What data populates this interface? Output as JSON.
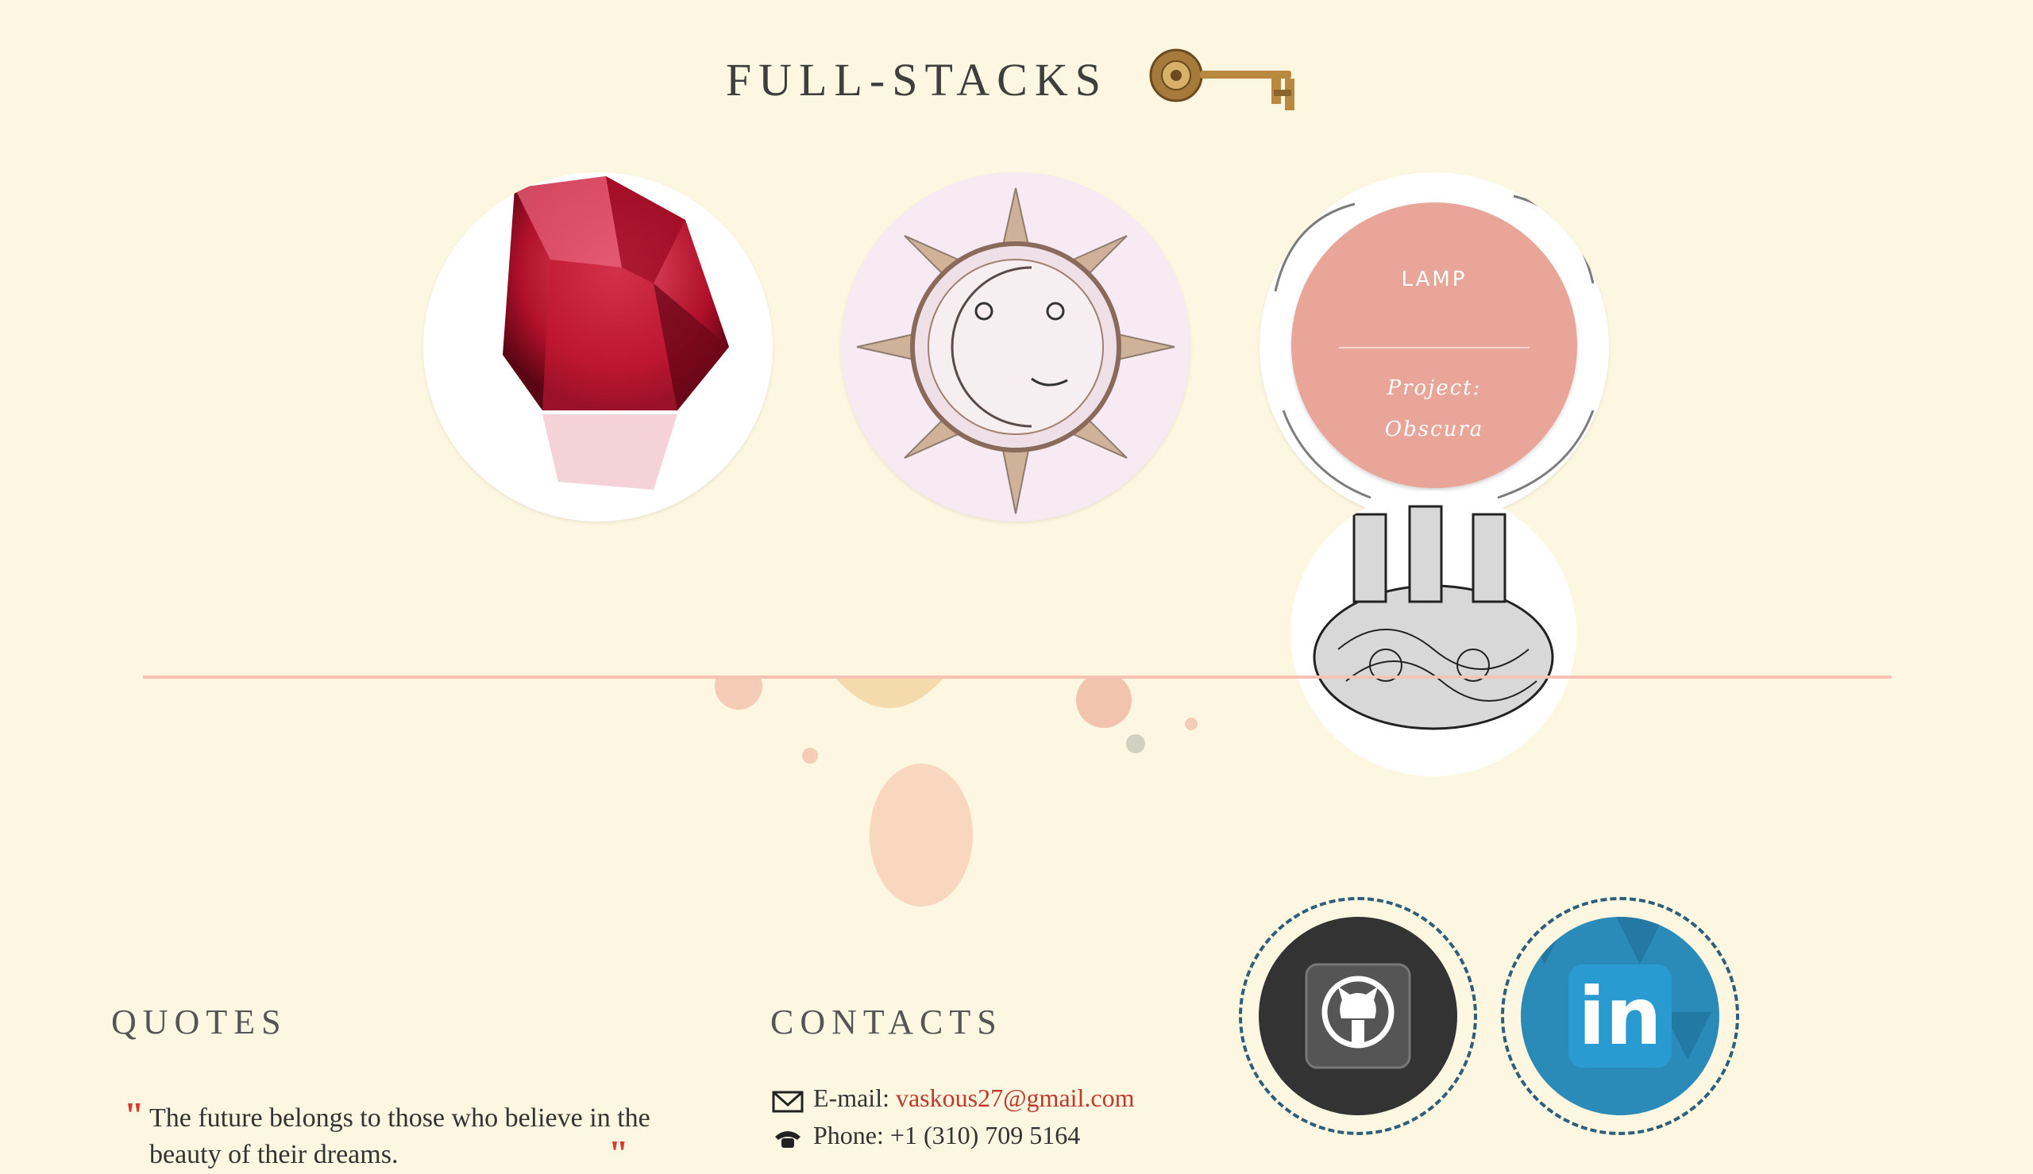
{
  "header": {
    "title": "FULL-STACKS",
    "logo_icon": "key-icon"
  },
  "projects": [
    {
      "name": "ruby-gem-image"
    },
    {
      "name": "sun-moon-image"
    },
    {
      "name": "elephant-image",
      "overlay": {
        "title": "LAMP",
        "subtitle_line1": "Project:",
        "subtitle_line2": "Obscura"
      }
    },
    {
      "name": "elephant-image-2"
    }
  ],
  "quotes": {
    "heading": "QUOTES",
    "text": "The future belongs to those who believe in the beauty of their dreams."
  },
  "contacts": {
    "heading": "CONTACTS",
    "email_label": "E-mail: ",
    "email": "vaskous27@gmail.com",
    "phone_label": "Phone: ",
    "phone": "+1 (310) 709 5164"
  },
  "social": [
    {
      "name": "GitHub",
      "icon": "github-icon"
    },
    {
      "name": "LinkedIn",
      "icon": "linkedin-icon",
      "label": "in"
    }
  ],
  "colors": {
    "background": "#fdf6e0",
    "accent": "#e8a598",
    "divider": "#f6c2b6",
    "link": "#c0392b",
    "ring": "#2d5e7a"
  }
}
